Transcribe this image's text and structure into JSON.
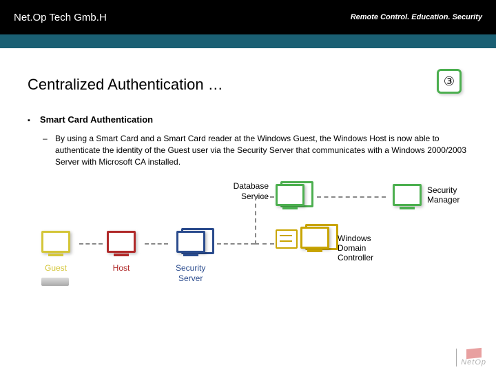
{
  "header": {
    "company": "Net.Op Tech Gmb.H",
    "tagline": "Remote Control. Education. Security"
  },
  "slide": {
    "number": "③",
    "title": "Centralized Authentication …"
  },
  "bullet": {
    "heading": "Smart Card Authentication",
    "body": "By using a Smart Card and a Smart Card reader at the Windows Guest, the Windows Host is now able to authenticate the identity of the Guest user via the Security Server that communicates with a Windows 2000/2003 Server with Microsoft CA installed."
  },
  "diagram": {
    "guest": "Guest",
    "host": "Host",
    "security_server": "Security\nServer",
    "database_service": "Database\nService",
    "windows_domain_controller": "Windows\nDomain\nController",
    "security_manager": "Security\nManager"
  },
  "footer": {
    "brand": "NetOp"
  }
}
